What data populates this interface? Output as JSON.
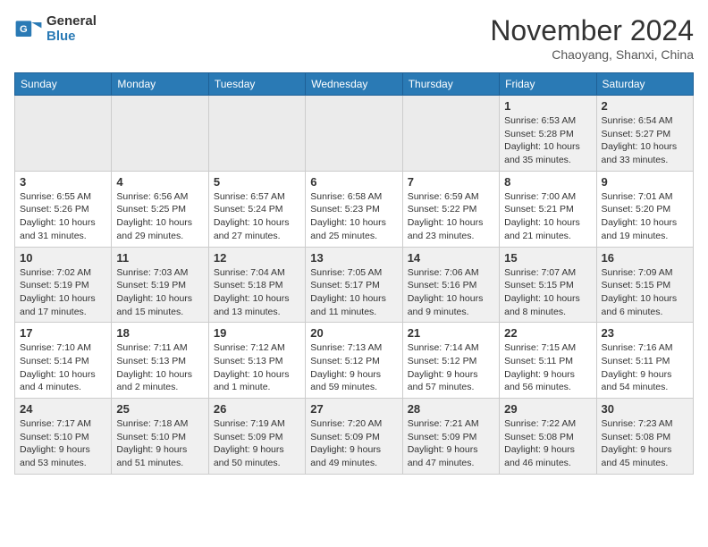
{
  "header": {
    "logo_general": "General",
    "logo_blue": "Blue",
    "month_title": "November 2024",
    "subtitle": "Chaoyang, Shanxi, China"
  },
  "weekdays": [
    "Sunday",
    "Monday",
    "Tuesday",
    "Wednesday",
    "Thursday",
    "Friday",
    "Saturday"
  ],
  "weeks": [
    [
      {
        "day": "",
        "info": ""
      },
      {
        "day": "",
        "info": ""
      },
      {
        "day": "",
        "info": ""
      },
      {
        "day": "",
        "info": ""
      },
      {
        "day": "",
        "info": ""
      },
      {
        "day": "1",
        "info": "Sunrise: 6:53 AM\nSunset: 5:28 PM\nDaylight: 10 hours and 35 minutes."
      },
      {
        "day": "2",
        "info": "Sunrise: 6:54 AM\nSunset: 5:27 PM\nDaylight: 10 hours and 33 minutes."
      }
    ],
    [
      {
        "day": "3",
        "info": "Sunrise: 6:55 AM\nSunset: 5:26 PM\nDaylight: 10 hours and 31 minutes."
      },
      {
        "day": "4",
        "info": "Sunrise: 6:56 AM\nSunset: 5:25 PM\nDaylight: 10 hours and 29 minutes."
      },
      {
        "day": "5",
        "info": "Sunrise: 6:57 AM\nSunset: 5:24 PM\nDaylight: 10 hours and 27 minutes."
      },
      {
        "day": "6",
        "info": "Sunrise: 6:58 AM\nSunset: 5:23 PM\nDaylight: 10 hours and 25 minutes."
      },
      {
        "day": "7",
        "info": "Sunrise: 6:59 AM\nSunset: 5:22 PM\nDaylight: 10 hours and 23 minutes."
      },
      {
        "day": "8",
        "info": "Sunrise: 7:00 AM\nSunset: 5:21 PM\nDaylight: 10 hours and 21 minutes."
      },
      {
        "day": "9",
        "info": "Sunrise: 7:01 AM\nSunset: 5:20 PM\nDaylight: 10 hours and 19 minutes."
      }
    ],
    [
      {
        "day": "10",
        "info": "Sunrise: 7:02 AM\nSunset: 5:19 PM\nDaylight: 10 hours and 17 minutes."
      },
      {
        "day": "11",
        "info": "Sunrise: 7:03 AM\nSunset: 5:19 PM\nDaylight: 10 hours and 15 minutes."
      },
      {
        "day": "12",
        "info": "Sunrise: 7:04 AM\nSunset: 5:18 PM\nDaylight: 10 hours and 13 minutes."
      },
      {
        "day": "13",
        "info": "Sunrise: 7:05 AM\nSunset: 5:17 PM\nDaylight: 10 hours and 11 minutes."
      },
      {
        "day": "14",
        "info": "Sunrise: 7:06 AM\nSunset: 5:16 PM\nDaylight: 10 hours and 9 minutes."
      },
      {
        "day": "15",
        "info": "Sunrise: 7:07 AM\nSunset: 5:15 PM\nDaylight: 10 hours and 8 minutes."
      },
      {
        "day": "16",
        "info": "Sunrise: 7:09 AM\nSunset: 5:15 PM\nDaylight: 10 hours and 6 minutes."
      }
    ],
    [
      {
        "day": "17",
        "info": "Sunrise: 7:10 AM\nSunset: 5:14 PM\nDaylight: 10 hours and 4 minutes."
      },
      {
        "day": "18",
        "info": "Sunrise: 7:11 AM\nSunset: 5:13 PM\nDaylight: 10 hours and 2 minutes."
      },
      {
        "day": "19",
        "info": "Sunrise: 7:12 AM\nSunset: 5:13 PM\nDaylight: 10 hours and 1 minute."
      },
      {
        "day": "20",
        "info": "Sunrise: 7:13 AM\nSunset: 5:12 PM\nDaylight: 9 hours and 59 minutes."
      },
      {
        "day": "21",
        "info": "Sunrise: 7:14 AM\nSunset: 5:12 PM\nDaylight: 9 hours and 57 minutes."
      },
      {
        "day": "22",
        "info": "Sunrise: 7:15 AM\nSunset: 5:11 PM\nDaylight: 9 hours and 56 minutes."
      },
      {
        "day": "23",
        "info": "Sunrise: 7:16 AM\nSunset: 5:11 PM\nDaylight: 9 hours and 54 minutes."
      }
    ],
    [
      {
        "day": "24",
        "info": "Sunrise: 7:17 AM\nSunset: 5:10 PM\nDaylight: 9 hours and 53 minutes."
      },
      {
        "day": "25",
        "info": "Sunrise: 7:18 AM\nSunset: 5:10 PM\nDaylight: 9 hours and 51 minutes."
      },
      {
        "day": "26",
        "info": "Sunrise: 7:19 AM\nSunset: 5:09 PM\nDaylight: 9 hours and 50 minutes."
      },
      {
        "day": "27",
        "info": "Sunrise: 7:20 AM\nSunset: 5:09 PM\nDaylight: 9 hours and 49 minutes."
      },
      {
        "day": "28",
        "info": "Sunrise: 7:21 AM\nSunset: 5:09 PM\nDaylight: 9 hours and 47 minutes."
      },
      {
        "day": "29",
        "info": "Sunrise: 7:22 AM\nSunset: 5:08 PM\nDaylight: 9 hours and 46 minutes."
      },
      {
        "day": "30",
        "info": "Sunrise: 7:23 AM\nSunset: 5:08 PM\nDaylight: 9 hours and 45 minutes."
      }
    ]
  ]
}
